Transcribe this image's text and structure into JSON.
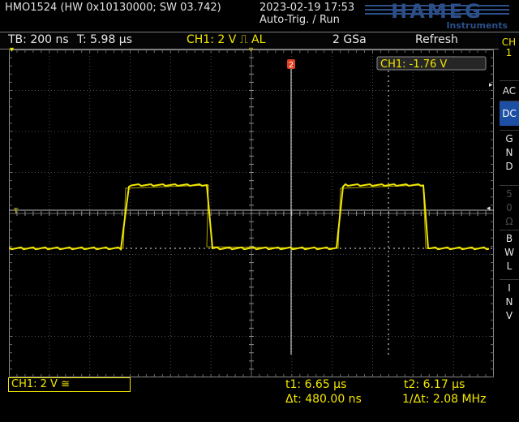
{
  "header": {
    "device_info": "HMO1524 (HW 0x10130000; SW 03.742)",
    "datetime": "2023-02-19 17:53",
    "trigger_status": "Auto-Trig. / Run",
    "brand": "HAMEG",
    "brand_sub": "Instruments"
  },
  "top_bar": {
    "timebase": "TB: 200 ns",
    "trigger_time": "T: 5.98 µs",
    "ch1_setting": "CH1: 2 V ⎍ AL",
    "sample_rate": "2 GSa",
    "acq_mode": "Refresh"
  },
  "channel_tab": {
    "label": "CH\n1"
  },
  "side_menu": [
    {
      "label": "AC",
      "active": false
    },
    {
      "label": "DC",
      "active": true
    },
    {
      "label": "GND",
      "active": false
    },
    {
      "label": "50Ω",
      "active": false,
      "disabled": true
    },
    {
      "label": "BWL",
      "active": false
    },
    {
      "label": "INV",
      "active": false
    }
  ],
  "cursor_readout": {
    "label": "CH1: -1.76 V"
  },
  "cursor_marker": "2",
  "ground_marker": "1",
  "trigger_marker": "T",
  "bottom_bar": {
    "ch1_box": "CH1: 2 V ≅",
    "t1": "t1: 6.65 µs",
    "t2": "t2: 6.17 µs",
    "delta_t": "Δt: 480.00 ns",
    "inv_delta_t": "1/Δt: 2.08 MHz"
  },
  "colors": {
    "trace": "#f2e600",
    "grid": "#555555",
    "accent_blue": "#1d4fa5",
    "cursor_marker": "#e04020"
  }
}
